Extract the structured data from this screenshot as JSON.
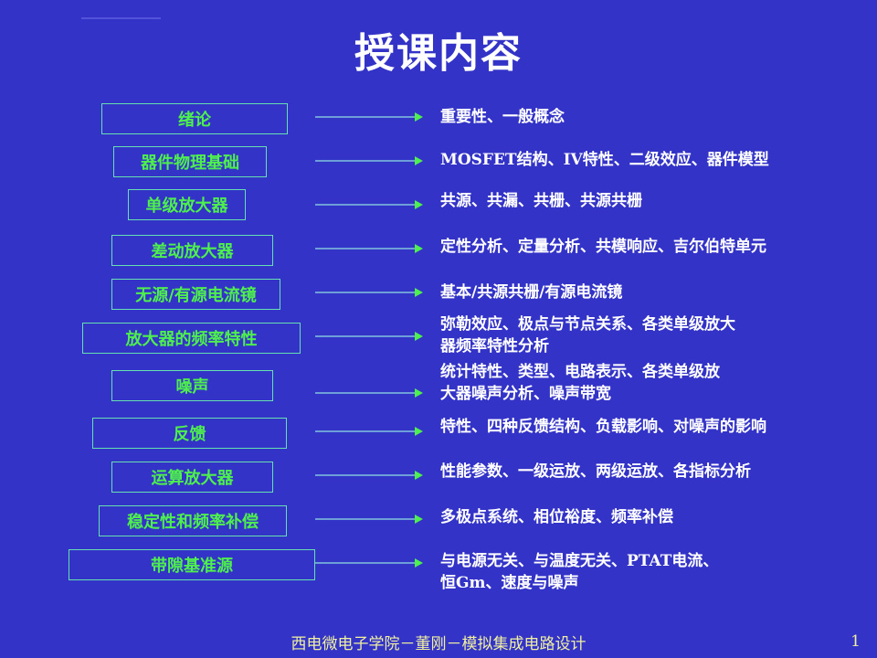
{
  "slide": {
    "title": "授课内容",
    "footer": "西电微电子学院－董刚－模拟集成电路设计",
    "page_number": "1",
    "colors": {
      "background": "#3333c8",
      "topic_text": "#4ef04e",
      "topic_border": "#66e0b0",
      "arrow_shaft": "#6f9fd8",
      "arrow_head": "#4ef04e",
      "desc_text": "#ffffff",
      "footer_text": "#f0f0a0"
    }
  },
  "topics": [
    {
      "label": "绪论",
      "description": [
        "重要性、一般概念"
      ]
    },
    {
      "label": "器件物理基础",
      "description": [
        "MOSFET结构、IV特性、二级效应、器件模型"
      ]
    },
    {
      "label": "单级放大器",
      "description": [
        "共源、共漏、共栅、共源共栅"
      ]
    },
    {
      "label": "差动放大器",
      "description": [
        "定性分析、定量分析、共模响应、吉尔伯特单元"
      ]
    },
    {
      "label": "无源/有源电流镜",
      "description": [
        "基本/共源共栅/有源电流镜"
      ]
    },
    {
      "label": "放大器的频率特性",
      "description": [
        "弥勒效应、极点与节点关系、各类单级放大",
        "器频率特性分析"
      ]
    },
    {
      "label": "噪声",
      "description": [
        "统计特性、类型、电路表示、各类单级放",
        "大器噪声分析、噪声带宽"
      ]
    },
    {
      "label": "反馈",
      "description": [
        "特性、四种反馈结构、负载影响、对噪声的影响"
      ]
    },
    {
      "label": "运算放大器",
      "description": [
        "性能参数、一级运放、两级运放、各指标分析"
      ]
    },
    {
      "label": "稳定性和频率补偿",
      "description": [
        "多极点系统、相位裕度、频率补偿"
      ]
    },
    {
      "label": "带隙基准源",
      "description": [
        "与电源无关、与温度无关、PTAT电流、",
        "恒Gm、速度与噪声"
      ]
    }
  ]
}
